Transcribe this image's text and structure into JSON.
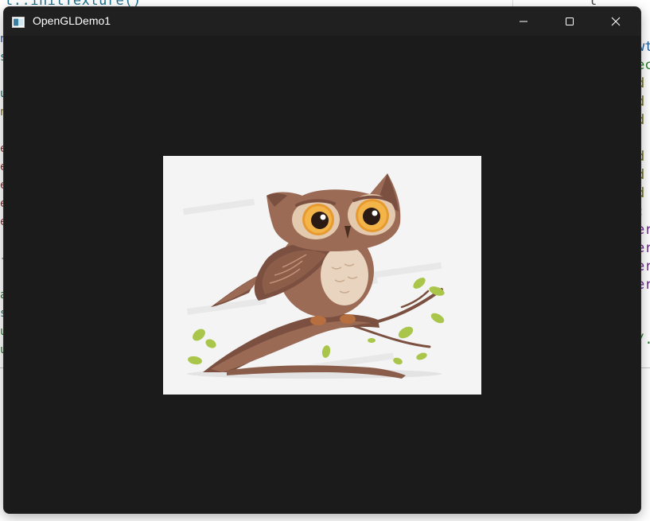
{
  "window": {
    "title": "OpenGLDemo1",
    "app_icon": "window-app-icon",
    "controls": {
      "minimize_icon": "minimize-icon",
      "maximize_icon": "maximize-icon",
      "close_icon": "close-icon"
    }
  },
  "texture": {
    "subject": "owl-on-branch-illustration"
  },
  "background_ide": {
    "top_code": "t::initTexture()",
    "top_right_code": "l",
    "right_fragments": [
      "wt",
      "ec",
      "d",
      "d",
      "d",
      "",
      "d",
      "d",
      "d",
      ":",
      "er",
      "er",
      "er",
      "er",
      "",
      "",
      "/."
    ],
    "left_fragments": [
      "n",
      "s",
      "",
      "u",
      "n",
      "",
      "e",
      "e",
      "e",
      "e",
      "e",
      "",
      "-",
      "",
      "a",
      "s",
      "u",
      "u"
    ]
  },
  "colors": {
    "window_bg": "#1c1b1c",
    "titlebar_bg": "#202020",
    "title_text": "#ffffff",
    "texture_bg": "#f3f3f3"
  }
}
